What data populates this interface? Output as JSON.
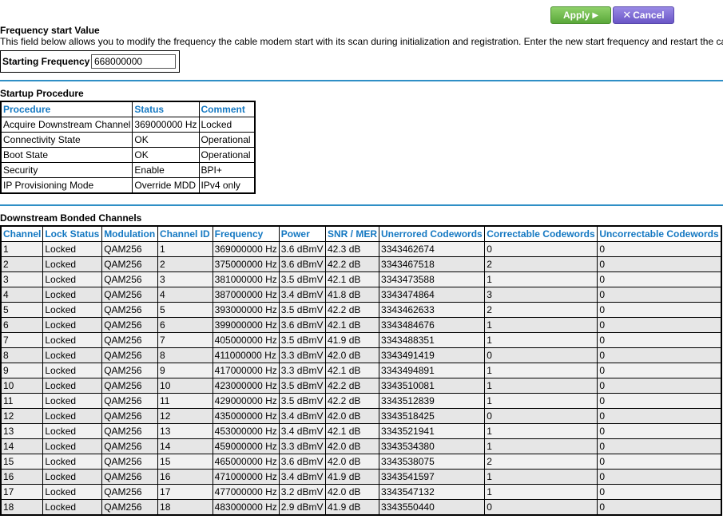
{
  "actions": {
    "apply_label": "Apply",
    "apply_glyph": "▶",
    "cancel_label": "Cancel",
    "cancel_glyph": "✕"
  },
  "frequency": {
    "title": "Frequency start Value",
    "description": "This field below allows you to modify the frequency the cable modem start with its scan during initialization and registration. Enter the new start frequency and restart the ca",
    "label": "Starting Frequency",
    "value": "668000000"
  },
  "startup": {
    "title": "Startup Procedure",
    "headers": [
      "Procedure",
      "Status",
      "Comment"
    ],
    "rows": [
      [
        "Acquire Downstream Channel",
        "369000000 Hz",
        "Locked"
      ],
      [
        "Connectivity State",
        "OK",
        "Operational"
      ],
      [
        "Boot State",
        "OK",
        "Operational"
      ],
      [
        "Security",
        "Enable",
        "BPI+"
      ],
      [
        "IP Provisioning Mode",
        "Override MDD",
        "IPv4 only"
      ]
    ]
  },
  "downstream": {
    "title": "Downstream Bonded Channels",
    "headers": [
      "Channel",
      "Lock Status",
      "Modulation",
      "Channel ID",
      "Frequency",
      "Power",
      "SNR / MER",
      "Unerrored Codewords",
      "Correctable Codewords",
      "Uncorrectable Codewords"
    ],
    "rows": [
      [
        "1",
        "Locked",
        "QAM256",
        "1",
        "369000000 Hz",
        "3.6 dBmV",
        "42.3 dB",
        "3343462674",
        "0",
        "0"
      ],
      [
        "2",
        "Locked",
        "QAM256",
        "2",
        "375000000 Hz",
        "3.6 dBmV",
        "42.2 dB",
        "3343467518",
        "2",
        "0"
      ],
      [
        "3",
        "Locked",
        "QAM256",
        "3",
        "381000000 Hz",
        "3.5 dBmV",
        "42.1 dB",
        "3343473588",
        "1",
        "0"
      ],
      [
        "4",
        "Locked",
        "QAM256",
        "4",
        "387000000 Hz",
        "3.4 dBmV",
        "41.8 dB",
        "3343474864",
        "3",
        "0"
      ],
      [
        "5",
        "Locked",
        "QAM256",
        "5",
        "393000000 Hz",
        "3.5 dBmV",
        "42.2 dB",
        "3343462633",
        "2",
        "0"
      ],
      [
        "6",
        "Locked",
        "QAM256",
        "6",
        "399000000 Hz",
        "3.6 dBmV",
        "42.1 dB",
        "3343484676",
        "1",
        "0"
      ],
      [
        "7",
        "Locked",
        "QAM256",
        "7",
        "405000000 Hz",
        "3.5 dBmV",
        "41.9 dB",
        "3343488351",
        "1",
        "0"
      ],
      [
        "8",
        "Locked",
        "QAM256",
        "8",
        "411000000 Hz",
        "3.3 dBmV",
        "42.0 dB",
        "3343491419",
        "0",
        "0"
      ],
      [
        "9",
        "Locked",
        "QAM256",
        "9",
        "417000000 Hz",
        "3.3 dBmV",
        "42.1 dB",
        "3343494891",
        "1",
        "0"
      ],
      [
        "10",
        "Locked",
        "QAM256",
        "10",
        "423000000 Hz",
        "3.5 dBmV",
        "42.2 dB",
        "3343510081",
        "1",
        "0"
      ],
      [
        "11",
        "Locked",
        "QAM256",
        "11",
        "429000000 Hz",
        "3.5 dBmV",
        "42.2 dB",
        "3343512839",
        "1",
        "0"
      ],
      [
        "12",
        "Locked",
        "QAM256",
        "12",
        "435000000 Hz",
        "3.4 dBmV",
        "42.0 dB",
        "3343518425",
        "0",
        "0"
      ],
      [
        "13",
        "Locked",
        "QAM256",
        "13",
        "453000000 Hz",
        "3.4 dBmV",
        "42.1 dB",
        "3343521941",
        "1",
        "0"
      ],
      [
        "14",
        "Locked",
        "QAM256",
        "14",
        "459000000 Hz",
        "3.3 dBmV",
        "42.0 dB",
        "3343534380",
        "1",
        "0"
      ],
      [
        "15",
        "Locked",
        "QAM256",
        "15",
        "465000000 Hz",
        "3.6 dBmV",
        "42.0 dB",
        "3343538075",
        "2",
        "0"
      ],
      [
        "16",
        "Locked",
        "QAM256",
        "16",
        "471000000 Hz",
        "3.4 dBmV",
        "41.9 dB",
        "3343541597",
        "1",
        "0"
      ],
      [
        "17",
        "Locked",
        "QAM256",
        "17",
        "477000000 Hz",
        "3.2 dBmV",
        "42.0 dB",
        "3343547132",
        "1",
        "0"
      ],
      [
        "18",
        "Locked",
        "QAM256",
        "18",
        "483000000 Hz",
        "2.9 dBmV",
        "41.9 dB",
        "3343550440",
        "0",
        "0"
      ]
    ]
  },
  "colors": {
    "header_text": "#1478c2",
    "divider": "#2f8fc6",
    "apply_button": "#6cba47",
    "cancel_button": "#7a66d4"
  }
}
